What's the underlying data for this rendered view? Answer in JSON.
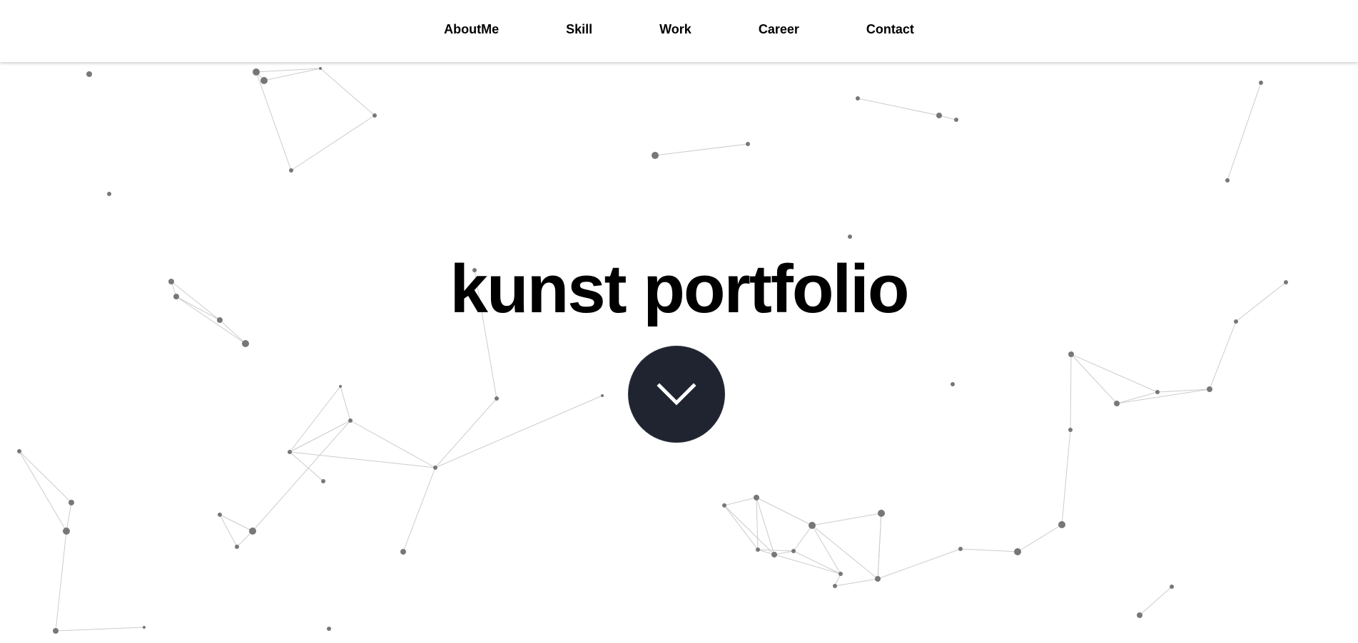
{
  "nav": {
    "items": [
      {
        "label": "AboutMe"
      },
      {
        "label": "Skill"
      },
      {
        "label": "Work"
      },
      {
        "label": "Career"
      },
      {
        "label": "Contact"
      }
    ]
  },
  "hero": {
    "title": "kunst portfolio",
    "scroll_icon": "chevron-down-icon"
  },
  "colors": {
    "background": "#ffffff",
    "text": "#000000",
    "button": "#1f2430",
    "particle": "#777777",
    "link": "#cccccc"
  }
}
